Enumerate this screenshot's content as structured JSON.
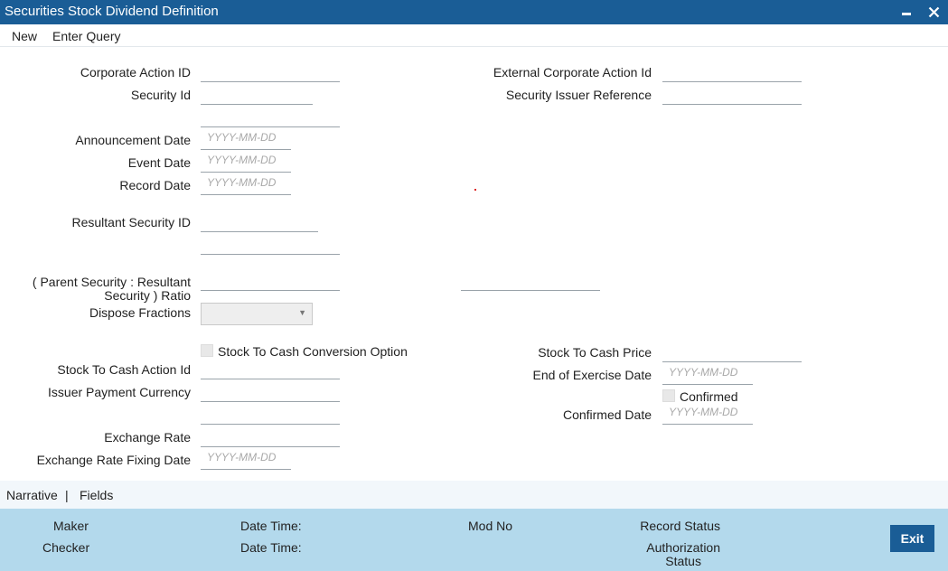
{
  "window": {
    "title": "Securities Stock Dividend Definition",
    "minimize_icon": "minimize-icon",
    "close_icon": "close-icon",
    "close_glyph": "✕"
  },
  "menu": {
    "new": "New",
    "enter_query": "Enter Query"
  },
  "form": {
    "corporate_action_id": {
      "label": "Corporate Action ID",
      "value": ""
    },
    "external_corporate_action_id": {
      "label": "External Corporate Action Id",
      "value": ""
    },
    "security_id": {
      "label": "Security Id",
      "value": ""
    },
    "security_issuer_reference": {
      "label": "Security Issuer Reference",
      "value": ""
    },
    "security_description": {
      "value": ""
    },
    "announcement_date": {
      "label": "Announcement Date",
      "placeholder": "YYYY-MM-DD"
    },
    "event_date": {
      "label": "Event Date",
      "placeholder": "YYYY-MM-DD"
    },
    "record_date": {
      "label": "Record Date",
      "placeholder": "YYYY-MM-DD"
    },
    "resultant_security_id": {
      "label": "Resultant Security ID",
      "value": ""
    },
    "resultant_security_description": {
      "value": ""
    },
    "ratio": {
      "label_line1": "( Parent Security : Resultant",
      "label_line2": "Security ) Ratio",
      "parent_value": "",
      "resultant_value": ""
    },
    "dispose_fractions": {
      "label": "Dispose Fractions",
      "value": ""
    },
    "stock_to_cash_conversion_option": {
      "label": "Stock To Cash Conversion Option",
      "checked": false
    },
    "stock_to_cash_price": {
      "label": "Stock To Cash Price",
      "value": ""
    },
    "stock_to_cash_action_id": {
      "label": "Stock To Cash Action Id",
      "value": ""
    },
    "end_of_exercise_date": {
      "label": "End of Exercise Date",
      "placeholder": "YYYY-MM-DD"
    },
    "issuer_payment_currency": {
      "label": "Issuer Payment Currency",
      "value": ""
    },
    "currency_description": {
      "value": ""
    },
    "confirmed": {
      "label": "Confirmed",
      "checked": false
    },
    "confirmed_date": {
      "label": "Confirmed Date",
      "placeholder": "YYYY-MM-DD"
    },
    "exchange_rate": {
      "label": "Exchange Rate",
      "value": ""
    },
    "exchange_rate_fixing_date": {
      "label": "Exchange Rate Fixing Date",
      "placeholder": "YYYY-MM-DD"
    }
  },
  "tabs": {
    "narrative": "Narrative",
    "separator": "|",
    "fields": "Fields"
  },
  "footer": {
    "maker": "Maker",
    "checker": "Checker",
    "date_time_1": "Date Time:",
    "date_time_2": "Date Time:",
    "mod_no": "Mod No",
    "record_status": "Record Status",
    "authorization_status_line1": "Authorization",
    "authorization_status_line2": "Status",
    "exit": "Exit"
  },
  "colors": {
    "titlebar": "#1a5d96",
    "footer": "#b3d9ec",
    "exit_button": "#1a5d96"
  }
}
